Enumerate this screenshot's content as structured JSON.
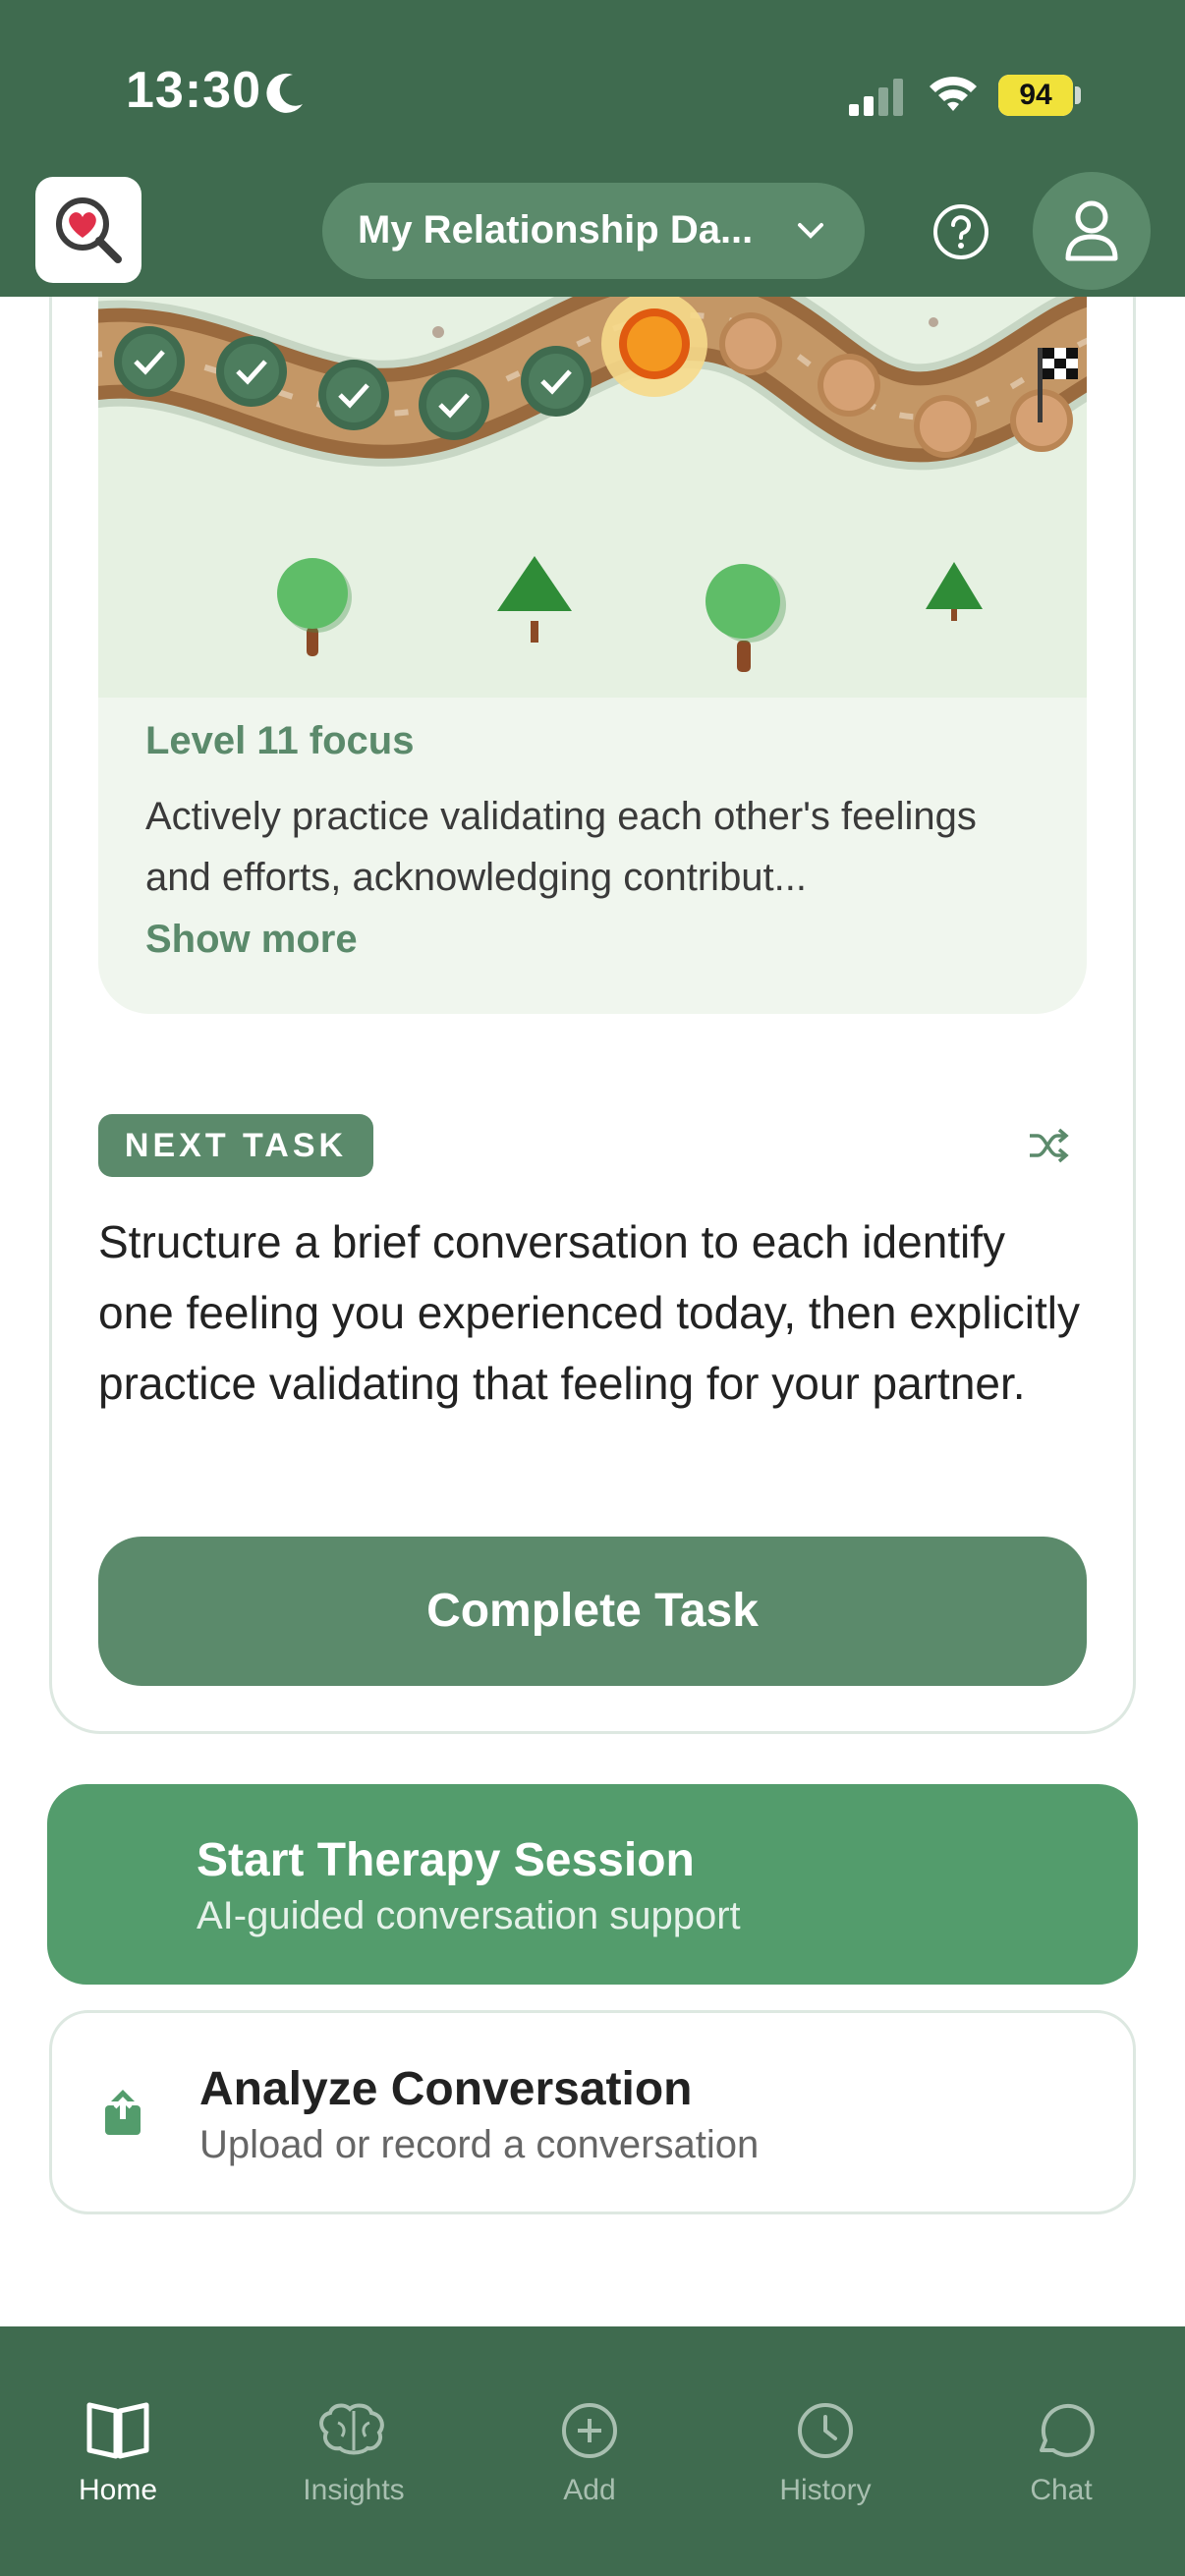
{
  "status_bar": {
    "time": "13:30",
    "battery_level": "94",
    "icons": [
      "moon-icon",
      "signal-icon",
      "wifi-icon",
      "battery-icon"
    ]
  },
  "header": {
    "selector_label": "My Relationship Da...",
    "icons": [
      "heart-search-logo-icon",
      "chevron-down-icon",
      "help-icon",
      "profile-icon"
    ]
  },
  "progress_path": {
    "completed_steps": 5,
    "current_step": 6,
    "upcoming_steps": 4
  },
  "focus": {
    "title": "Level 11 focus",
    "description": "Actively practice validating each other's feelings and efforts, acknowledging contribut...",
    "show_more": "Show more"
  },
  "task": {
    "badge": "NEXT TASK",
    "text": "Structure a brief conversation to each identify one feeling you experienced today, then explicitly practice validating that feeling for your partner.",
    "button": "Complete Task"
  },
  "actions": {
    "therapy_title": "Start Therapy Session",
    "therapy_subtitle": "AI-guided conversation support",
    "analyze_title": "Analyze Conversation",
    "analyze_subtitle": "Upload or record a conversation"
  },
  "nav": {
    "items": [
      {
        "label": "Home",
        "icon": "book-icon",
        "active": true
      },
      {
        "label": "Insights",
        "icon": "brain-icon",
        "active": false
      },
      {
        "label": "Add",
        "icon": "plus-circle-icon",
        "active": false
      },
      {
        "label": "History",
        "icon": "clock-icon",
        "active": false
      },
      {
        "label": "Chat",
        "icon": "chat-bubble-icon",
        "active": false
      }
    ]
  },
  "colors": {
    "header": "#3f6b4f",
    "accent": "#5b8a6b",
    "therapy_card": "#539c6c",
    "path_bg": "#e6f1e2"
  }
}
